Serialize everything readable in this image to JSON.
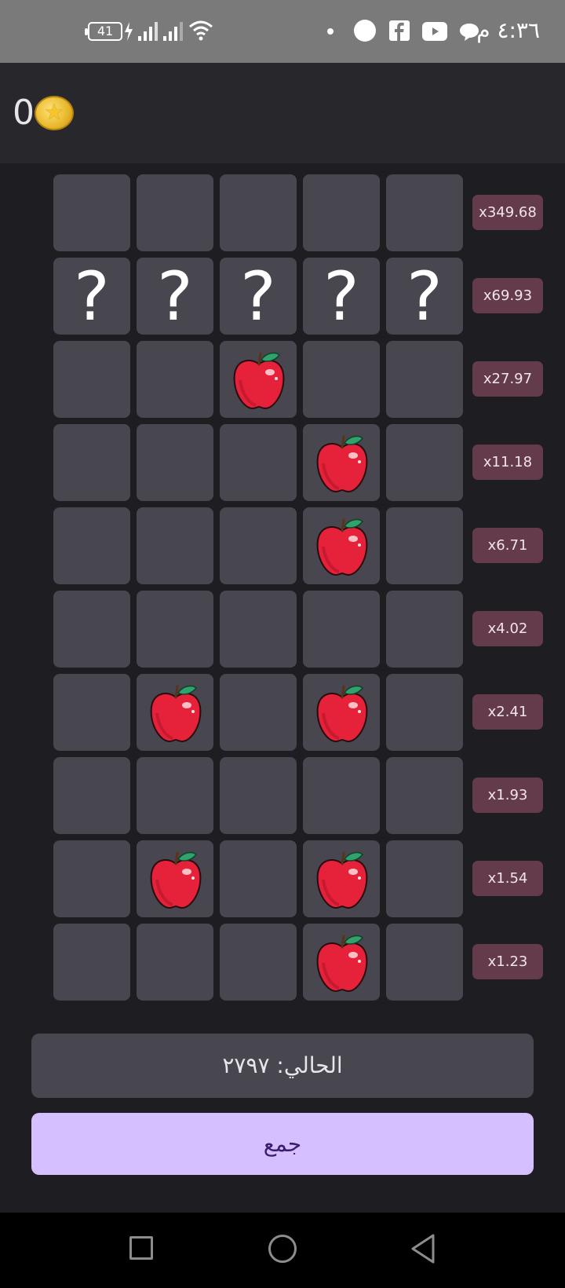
{
  "status_bar": {
    "time": "٤:٣٦ م",
    "battery": "41",
    "icons": [
      "battery-icon",
      "charging-icon",
      "signal-icon",
      "signal-icon",
      "wifi-icon",
      "dot-icon",
      "circle-icon",
      "facebook-icon",
      "youtube-icon",
      "chat-icon"
    ]
  },
  "header": {
    "coin_count": "0",
    "coin_icon": "coin-icon"
  },
  "grid": {
    "multipliers": [
      "x349.68",
      "x69.93",
      "x27.97",
      "x11.18",
      "x6.71",
      "x4.02",
      "x2.41",
      "x1.93",
      "x1.54",
      "x1.23"
    ],
    "question_mark": "?",
    "rows": [
      [
        "empty",
        "empty",
        "empty",
        "empty",
        "empty"
      ],
      [
        "question",
        "question",
        "question",
        "question",
        "question"
      ],
      [
        "empty",
        "empty",
        "apple",
        "empty",
        "empty"
      ],
      [
        "empty",
        "empty",
        "empty",
        "apple",
        "empty"
      ],
      [
        "empty",
        "empty",
        "empty",
        "apple",
        "empty"
      ],
      [
        "empty",
        "empty",
        "empty",
        "empty",
        "empty"
      ],
      [
        "empty",
        "apple",
        "empty",
        "apple",
        "empty"
      ],
      [
        "empty",
        "empty",
        "empty",
        "empty",
        "empty"
      ],
      [
        "empty",
        "apple",
        "empty",
        "apple",
        "empty"
      ],
      [
        "empty",
        "empty",
        "empty",
        "apple",
        "empty"
      ]
    ]
  },
  "current": {
    "label": "الحالي: ٢٧٩٧"
  },
  "collect_button": {
    "label": "جمع"
  },
  "nav": {
    "icons": [
      "recents-icon",
      "home-icon",
      "back-icon"
    ]
  },
  "colors": {
    "cell": "#48464e",
    "multiplier_bg": "#633b4a",
    "button": "#d6bfff",
    "apple": "#e5223a"
  }
}
